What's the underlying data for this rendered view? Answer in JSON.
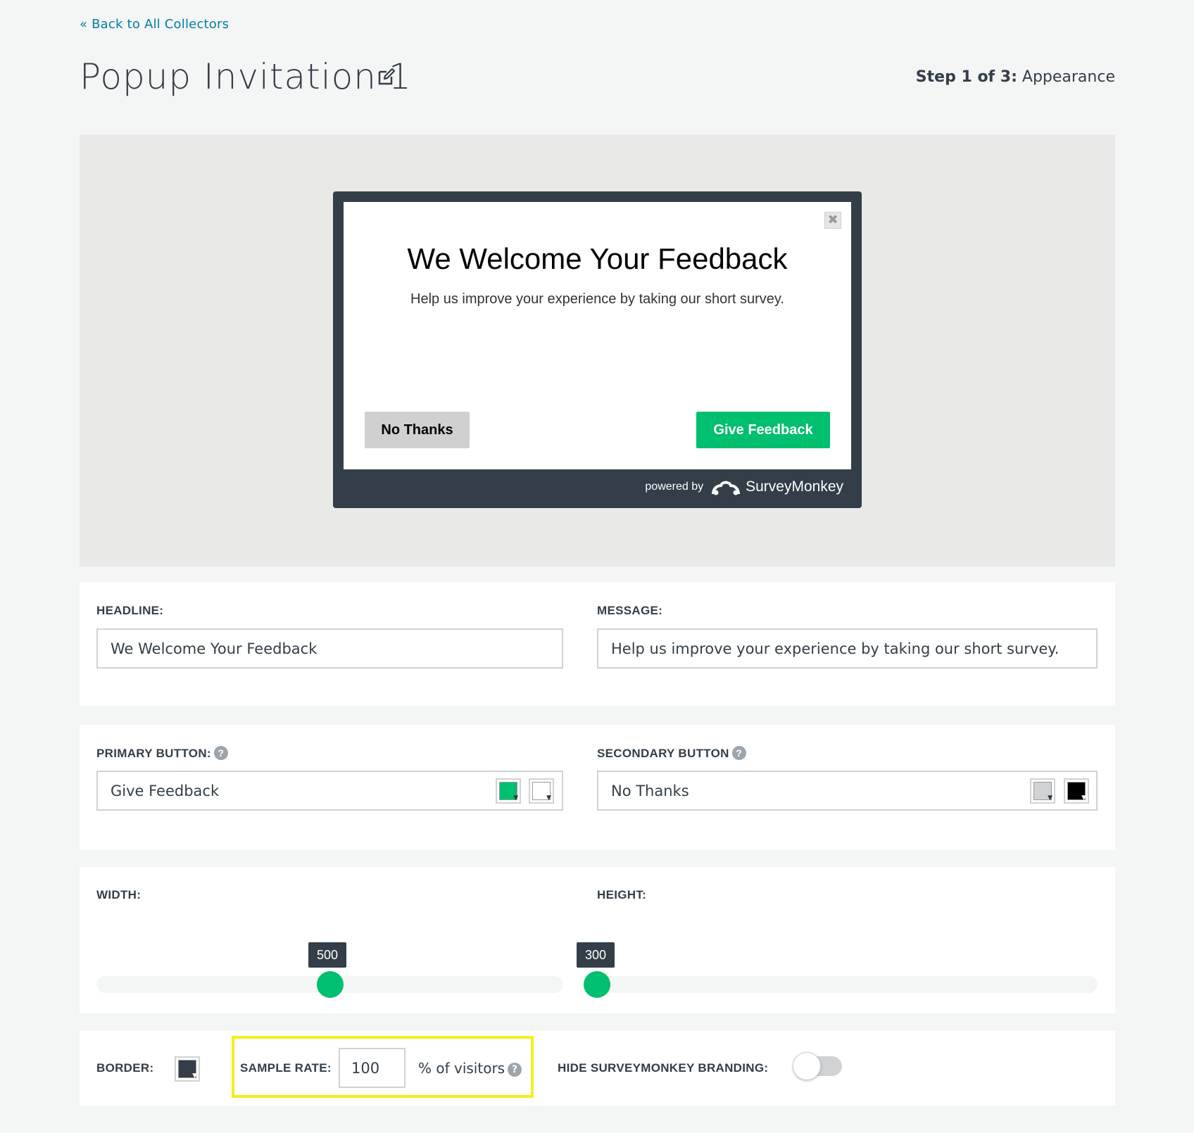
{
  "nav": {
    "back_link": "« Back to All Collectors"
  },
  "header": {
    "title": "Popup Invitation 1",
    "step_prefix": "Step 1 of 3:",
    "step_name": "Appearance"
  },
  "preview": {
    "headline": "We Welcome Your Feedback",
    "message": "Help us improve your experience by taking our short survey.",
    "secondary_button": "No Thanks",
    "primary_button": "Give Feedback",
    "powered_by": "powered by",
    "brand": "SurveyMonkey",
    "close_glyph": "✖"
  },
  "form": {
    "headline_label": "HEADLINE:",
    "headline_value": "We Welcome Your Feedback",
    "message_label": "MESSAGE:",
    "message_value": "Help us improve your experience by taking our short survey.",
    "primary_button_label": "PRIMARY BUTTON:",
    "primary_button_value": "Give Feedback",
    "primary_button_colors": [
      "#00bf6f",
      "#ffffff"
    ],
    "secondary_button_label": "SECONDARY BUTTON",
    "secondary_button_value": "No Thanks",
    "secondary_button_colors": [
      "#d0d2d3",
      "#000000"
    ],
    "help_glyph": "?",
    "width_label": "WIDTH:",
    "width_value": "500",
    "height_label": "HEIGHT:",
    "height_value": "300",
    "border_label": "BORDER:",
    "border_color": "#333e48",
    "sample_rate_label": "SAMPLE RATE:",
    "sample_rate_value": "100",
    "sample_rate_suffix": "% of visitors",
    "hide_branding_label": "HIDE SURVEYMONKEY BRANDING:",
    "hide_branding_on": false
  },
  "colors": {
    "accent": "#00bf6f",
    "dark": "#333e48",
    "link": "#007faa",
    "highlight": "#f5ee1d"
  }
}
